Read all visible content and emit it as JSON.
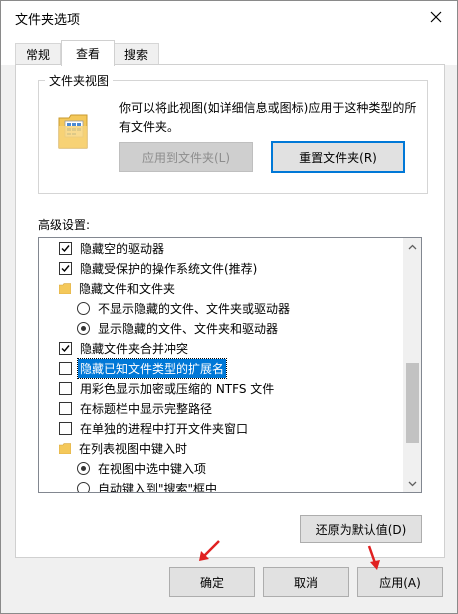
{
  "window": {
    "title": "文件夹选项"
  },
  "tabs": [
    {
      "label": "常规"
    },
    {
      "label": "查看",
      "active": true
    },
    {
      "label": "搜索"
    }
  ],
  "folder_views": {
    "legend": "文件夹视图",
    "description": "你可以将此视图(如详细信息或图标)应用于这种类型的所有文件夹。",
    "apply_button": "应用到文件夹(L)",
    "reset_button": "重置文件夹(R)"
  },
  "advanced": {
    "label": "高级设置:",
    "items": [
      {
        "type": "checkbox",
        "checked": true,
        "label": "隐藏空的驱动器"
      },
      {
        "type": "checkbox",
        "checked": true,
        "label": "隐藏受保护的操作系统文件(推荐)"
      },
      {
        "type": "folder",
        "label": "隐藏文件和文件夹"
      },
      {
        "type": "radio",
        "checked": false,
        "label": "不显示隐藏的文件、文件夹或驱动器"
      },
      {
        "type": "radio",
        "checked": true,
        "label": "显示隐藏的文件、文件夹和驱动器"
      },
      {
        "type": "checkbox",
        "checked": true,
        "label": "隐藏文件夹合并冲突"
      },
      {
        "type": "checkbox",
        "checked": false,
        "label": "隐藏已知文件类型的扩展名",
        "selected": true
      },
      {
        "type": "checkbox",
        "checked": false,
        "label": "用彩色显示加密或压缩的 NTFS 文件"
      },
      {
        "type": "checkbox",
        "checked": false,
        "label": "在标题栏中显示完整路径"
      },
      {
        "type": "checkbox",
        "checked": false,
        "label": "在单独的进程中打开文件夹窗口"
      },
      {
        "type": "folder",
        "label": "在列表视图中键入时"
      },
      {
        "type": "radio",
        "checked": true,
        "label": "在视图中选中键入项"
      },
      {
        "type": "radio",
        "checked": false,
        "label": "自动键入到\"搜索\"框中"
      }
    ]
  },
  "restore_defaults_button": "还原为默认值(D)",
  "footer": {
    "ok": "确定",
    "cancel": "取消",
    "apply": "应用(A)"
  },
  "colors": {
    "accent": "#0078d7",
    "annotation_arrow": "#e02020",
    "folder": "#f4c85a"
  }
}
